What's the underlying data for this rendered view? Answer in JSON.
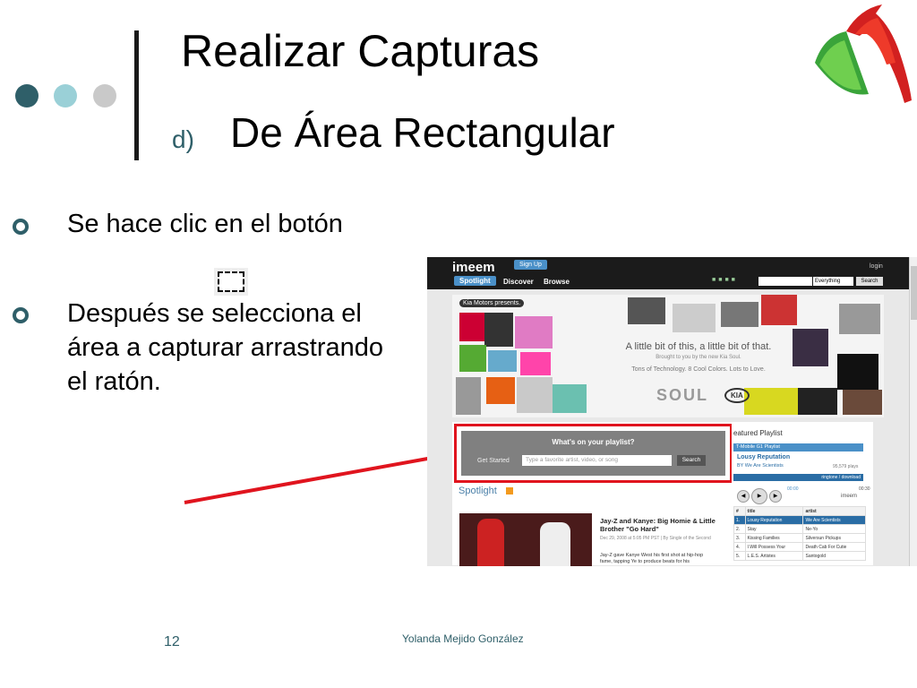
{
  "slide": {
    "title": "Realizar Capturas",
    "subtitle_marker": "d)",
    "subtitle": "De Área Rectangular",
    "bullets": [
      "Se hace clic en el botón",
      "Después se selecciona el área a capturar arrastrando el ratón."
    ],
    "page_number": "12",
    "author": "Yolanda Mejido González"
  },
  "colors": {
    "accent": "#2f5f69",
    "arrow": "#e0141e"
  },
  "screenshot": {
    "brand": "imeem",
    "signup": "Sign Up",
    "login": "login",
    "nav": [
      "Spotlight",
      "Discover",
      "Browse"
    ],
    "search_select": "Everything",
    "search_button": "Search",
    "banner": {
      "presenter": "Kia Motors presents.",
      "tagline": "A little bit of this, a little bit of that.",
      "line2": "Brought to you by the new Kia Soul.",
      "line3": "Tons of Technology. 8 Cool Colors. Lots to Love.",
      "soul": "SOUL",
      "kia": "KIA"
    },
    "playlist_box": {
      "question": "What's on your playlist?",
      "get_started": "Get Started",
      "placeholder": "Type a favorite artist, video, or song",
      "button": "Search"
    },
    "spotlight_heading": "Spotlight",
    "article": {
      "title": "Jay-Z and Kanye: Big Homie & Little Brother \"Go Hard\"",
      "meta": "Dec 29, 2008 at 5:05 PM PST | By Single of the Second",
      "body": "Jay-Z gave Kanye West his first shot at hip-hop fame, tapping Ye to produce beats for his"
    },
    "featured": {
      "heading": "eatured Playlist",
      "playlist_name": "T-Mobile G1 Playlist",
      "song": "Lousy Reputation",
      "by": "BY We Are Scientists",
      "plays": "95,579 plays",
      "links": "ringtone / download",
      "time_start": "00:00",
      "time_end": "00:30",
      "brand": "imeem",
      "columns": [
        "#",
        "title",
        "artist"
      ],
      "rows": [
        [
          "1.",
          "Lousy Reputation",
          "We Are Scientists"
        ],
        [
          "2.",
          "Stay",
          "Ne-Yo"
        ],
        [
          "3.",
          "Kissing Families",
          "Silversun Pickups"
        ],
        [
          "4.",
          "I Will Possess Your",
          "Death Cab For Cutie"
        ],
        [
          "5.",
          "L.E.S. Artistes",
          "Santogold"
        ]
      ]
    }
  }
}
